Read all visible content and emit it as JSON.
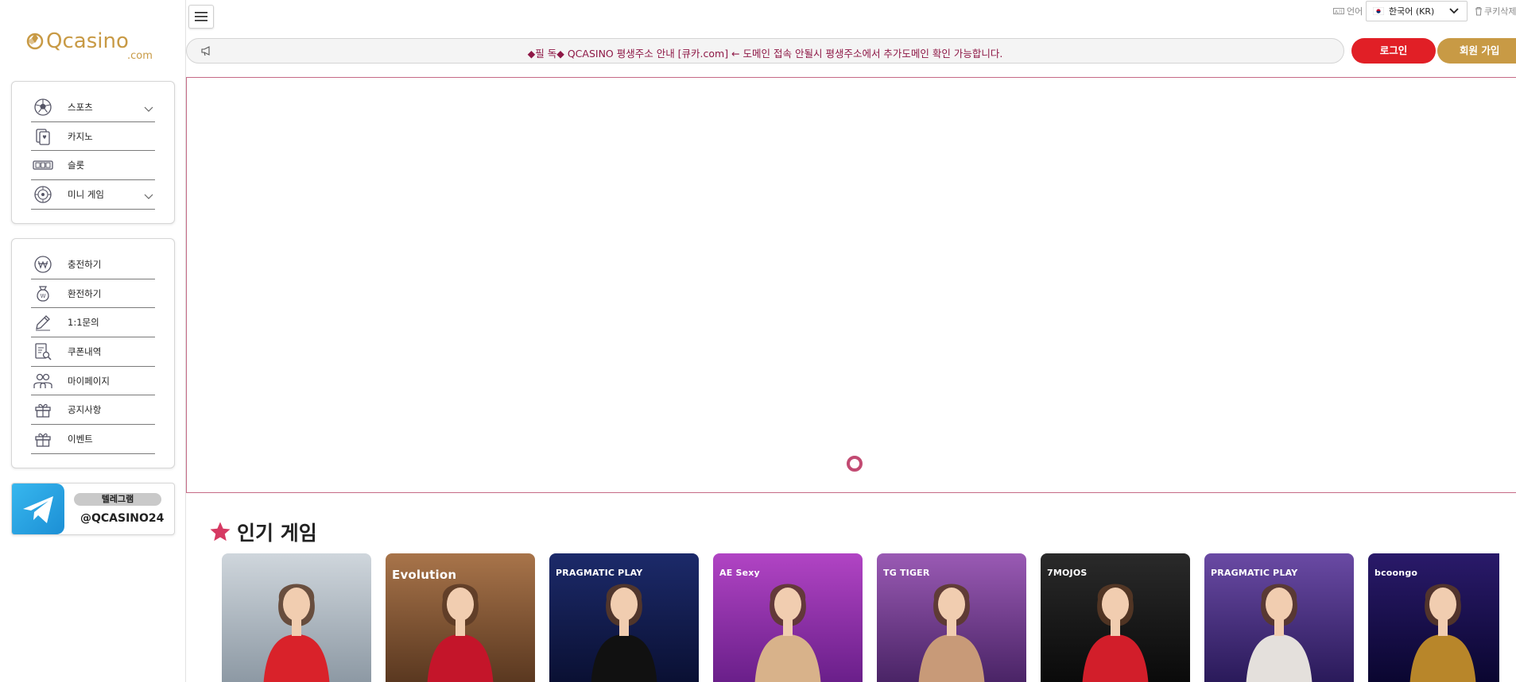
{
  "app": {
    "logo_text": "Qcasino",
    "logo_sub": ".com"
  },
  "menu_games": [
    {
      "label": "스포츠",
      "icon": "soccer-ball-icon",
      "has_submenu": true
    },
    {
      "label": "카지노",
      "icon": "playing-cards-icon",
      "has_submenu": false
    },
    {
      "label": "슬롯",
      "icon": "slot-machine-icon",
      "has_submenu": false
    },
    {
      "label": "미니 게임",
      "icon": "roulette-icon",
      "has_submenu": true
    }
  ],
  "menu_account": [
    {
      "label": "충전하기",
      "icon": "won-coin-icon"
    },
    {
      "label": "환전하기",
      "icon": "money-bag-icon"
    },
    {
      "label": "1:1문의",
      "icon": "pencil-icon"
    },
    {
      "label": "쿠폰내역",
      "icon": "document-search-icon"
    },
    {
      "label": "마이페이지",
      "icon": "users-icon"
    },
    {
      "label": "공지사항",
      "icon": "gift-icon"
    },
    {
      "label": "이벤트",
      "icon": "gift-icon"
    }
  ],
  "telegram": {
    "badge": "텔레그램",
    "handle": "@QCASINO24"
  },
  "topbar": {
    "language_label": "언어",
    "language_selected": "한국어 (KR)",
    "cookie_label": "쿠키삭제",
    "notice": "◆필 독◆ QCASINO 평생주소 안내 [큐카.com] ← 도메인 접속 안될시 평생주소에서 추가도메인 확인 가능합니다.",
    "login_label": "로그인",
    "join_label": "회원 가입"
  },
  "popular": {
    "title": "인기 게임",
    "tiles": [
      {
        "brand": "",
        "colors": [
          "#cfd6dc",
          "#8d99a4"
        ],
        "shirt": "#d9222a"
      },
      {
        "brand": "Evolution",
        "colors": [
          "#a8744a",
          "#5a3820"
        ],
        "shirt": "#c4152a"
      },
      {
        "brand": "PRAGMATIC PLAY",
        "colors": [
          "#1c2a6a",
          "#0a1033"
        ],
        "shirt": "#111111"
      },
      {
        "brand": "AE Sexy",
        "colors": [
          "#b144c4",
          "#6a1f8a"
        ],
        "shirt": "#d8b28a"
      },
      {
        "brand": "TG TIGER",
        "colors": [
          "#9a5ab4",
          "#4a2466"
        ],
        "shirt": "#c89a78"
      },
      {
        "brand": "7MOJOS",
        "colors": [
          "#2a2a2a",
          "#0a0a0a"
        ],
        "shirt": "#d21e2a"
      },
      {
        "brand": "PRAGMATIC PLAY",
        "colors": [
          "#6a4aa4",
          "#2a1a5a"
        ],
        "shirt": "#e4e0dc"
      },
      {
        "brand": "bcoongo",
        "colors": [
          "#2a1a6a",
          "#0a0630"
        ],
        "shirt": "#b8862a"
      }
    ]
  },
  "colors": {
    "primary_red": "#e11f26",
    "gold": "#c89a45",
    "notice_text": "#8e1846",
    "banner_border": "#c56a86",
    "accent_pink": "#c24a72"
  }
}
